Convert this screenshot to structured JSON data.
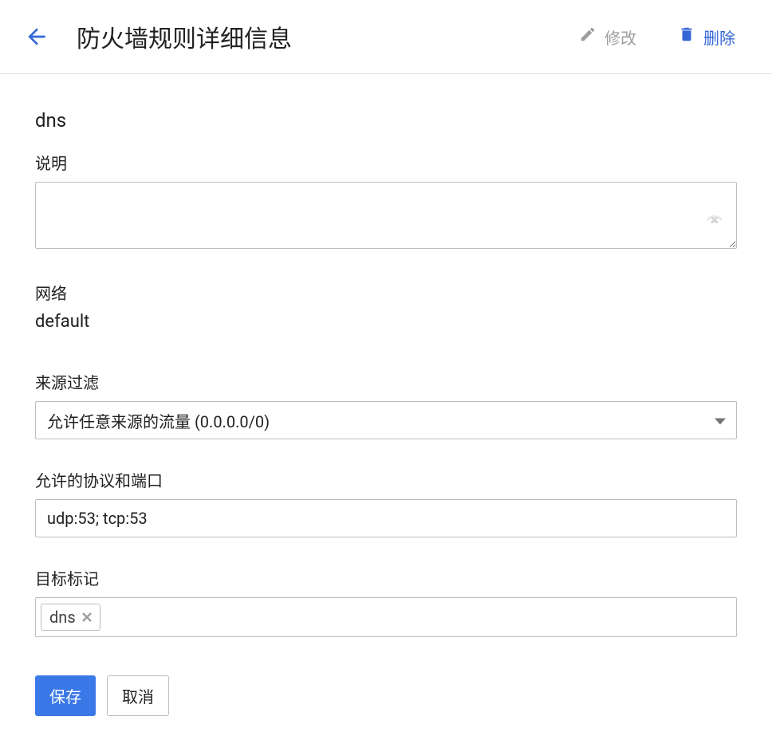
{
  "header": {
    "title": "防火墙规则详细信息",
    "edit_label": "修改",
    "delete_label": "删除"
  },
  "rule": {
    "name": "dns",
    "description_label": "说明",
    "description_value": "",
    "network_label": "网络",
    "network_value": "default",
    "source_filter_label": "来源过滤",
    "source_filter_value": "允许任意来源的流量 (0.0.0.0/0)",
    "protocols_label": "允许的协议和端口",
    "protocols_value": "udp:53; tcp:53",
    "target_tags_label": "目标标记",
    "target_tags": [
      "dns"
    ]
  },
  "footer": {
    "save_label": "保存",
    "cancel_label": "取消"
  }
}
